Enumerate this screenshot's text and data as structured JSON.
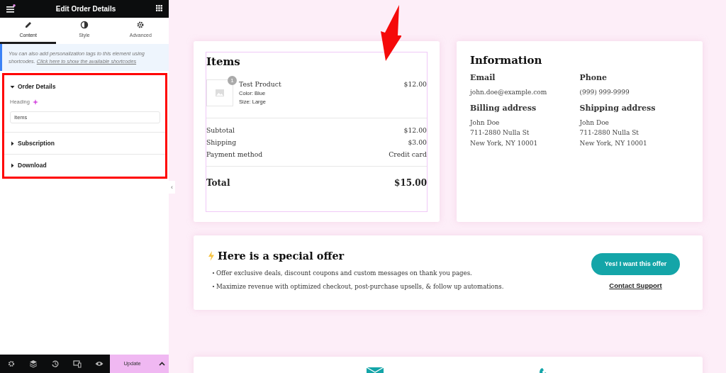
{
  "editor": {
    "title": "Edit Order Details",
    "tabs": [
      {
        "label": "Content",
        "selected": true
      },
      {
        "label": "Style",
        "selected": false
      },
      {
        "label": "Advanced",
        "selected": false
      }
    ],
    "notice": {
      "text": "You can also add personalization tags to this element using shortcodes.",
      "link": "Click here to show the available shortcodes"
    },
    "sections": [
      {
        "title": "Order Details",
        "expanded": true,
        "fields": [
          {
            "label": "Heading",
            "value": "Items"
          }
        ]
      },
      {
        "title": "Subscription",
        "expanded": false
      },
      {
        "title": "Download",
        "expanded": false
      }
    ],
    "collapse_handle": "‹",
    "footer": {
      "update_button": "Update"
    }
  },
  "preview": {
    "items_card": {
      "heading": "Items",
      "products": [
        {
          "name": "Test Product",
          "quantity": "1",
          "price": "$12.00",
          "attributes": [
            "Color: Blue",
            "Size: Large"
          ]
        }
      ],
      "totals": [
        {
          "label": "Subtotal",
          "value": "$12.00"
        },
        {
          "label": "Shipping",
          "value": "$3.00"
        },
        {
          "label": "Payment method",
          "value": "Credit card"
        }
      ],
      "total": {
        "label": "Total",
        "value": "$15.00"
      }
    },
    "information_card": {
      "heading": "Information",
      "fields": [
        {
          "label": "Email",
          "lines": [
            "john.doe@example.com"
          ]
        },
        {
          "label": "Phone",
          "lines": [
            "(999) 999-9999"
          ]
        },
        {
          "label": "Billing address",
          "lines": [
            "John Doe",
            "711-2880 Nulla St",
            "New York, NY 10001"
          ]
        },
        {
          "label": "Shipping address",
          "lines": [
            "John Doe",
            "711-2880 Nulla St",
            "New York, NY 10001"
          ]
        }
      ]
    },
    "offer": {
      "heading": "Here is a special offer",
      "bullets": [
        "Offer exclusive deals, discount coupons and custom messages on thank you pages.",
        "Maximize revenue with optimized checkout, post-purchase upsells, & follow up automations."
      ],
      "button": "Yes! I want this offer",
      "link": "Contact Support"
    }
  }
}
